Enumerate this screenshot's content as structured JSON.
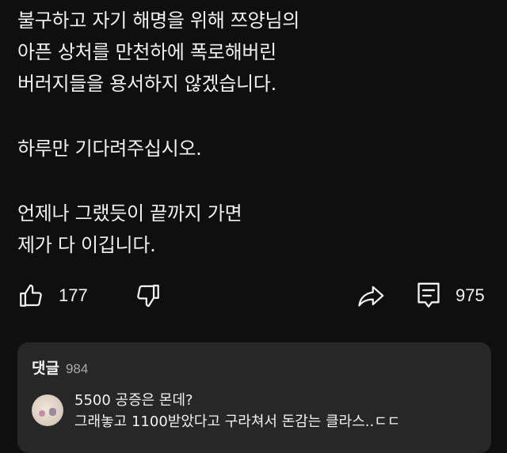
{
  "post": {
    "lines": [
      "불구하고 자기 해명을 위해 쯔양님의",
      "아픈 상처를 만천하에 폭로해버린",
      "버러지들을 용서하지 않겠습니다.",
      "하루만 기다려주십시오.",
      "언제나 그랬듯이 끝까지 가면",
      "제가 다 이깁니다."
    ]
  },
  "actions": {
    "like_count": "177",
    "comment_count": "975",
    "icons": [
      "thumbs-up-icon",
      "thumbs-down-icon",
      "share-icon",
      "comment-icon"
    ]
  },
  "comments": {
    "title": "댓글",
    "count": "984",
    "top_comment": {
      "line1": "5500 공증은 몬데?",
      "line2": "그래놓고 1100받았다고 구라쳐서 돈감는 클라스..ㄷㄷ"
    }
  },
  "colors": {
    "background": "#0f0f0f",
    "card": "#272727",
    "text": "#f1f1f1",
    "muted": "#aaaaaa"
  }
}
